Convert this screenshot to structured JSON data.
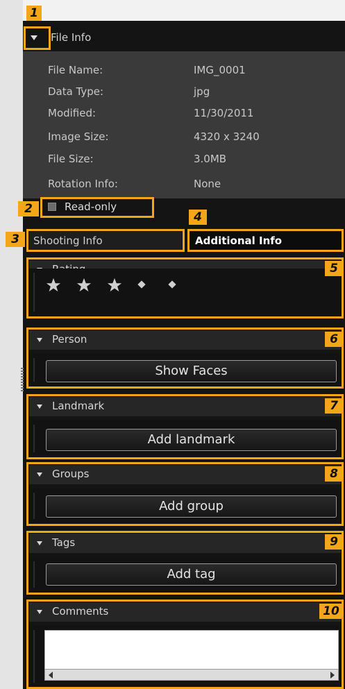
{
  "file_info": {
    "title": "File Info",
    "rows": [
      {
        "key": "File Name:",
        "value": "IMG_0001"
      },
      {
        "key": "Data Type:",
        "value": "jpg"
      },
      {
        "key": "Modified:",
        "value": "11/30/2011"
      },
      {
        "key": "Image Size:",
        "value": "4320 x 3240"
      },
      {
        "key": "File Size:",
        "value": "3.0MB"
      },
      {
        "key": "Rotation Info:",
        "value": "None"
      }
    ],
    "read_only_label": "Read-only",
    "read_only_checked": false
  },
  "tabs": [
    {
      "label": "Shooting Info",
      "selected": false
    },
    {
      "label": "Additional Info",
      "selected": true
    }
  ],
  "sections": {
    "rating": {
      "title": "Rating",
      "stars_filled": 3,
      "max_stars": 5
    },
    "person": {
      "title": "Person",
      "button": "Show Faces"
    },
    "landmark": {
      "title": "Landmark",
      "button": "Add landmark"
    },
    "groups": {
      "title": "Groups",
      "button": "Add group"
    },
    "tags": {
      "title": "Tags",
      "button": "Add tag"
    },
    "comments": {
      "title": "Comments",
      "value": ""
    }
  },
  "callouts": [
    "1",
    "2",
    "3",
    "4",
    "5",
    "6",
    "7",
    "8",
    "9",
    "10"
  ],
  "colors": {
    "highlight": "#f4a61a",
    "panel": "#141414"
  }
}
